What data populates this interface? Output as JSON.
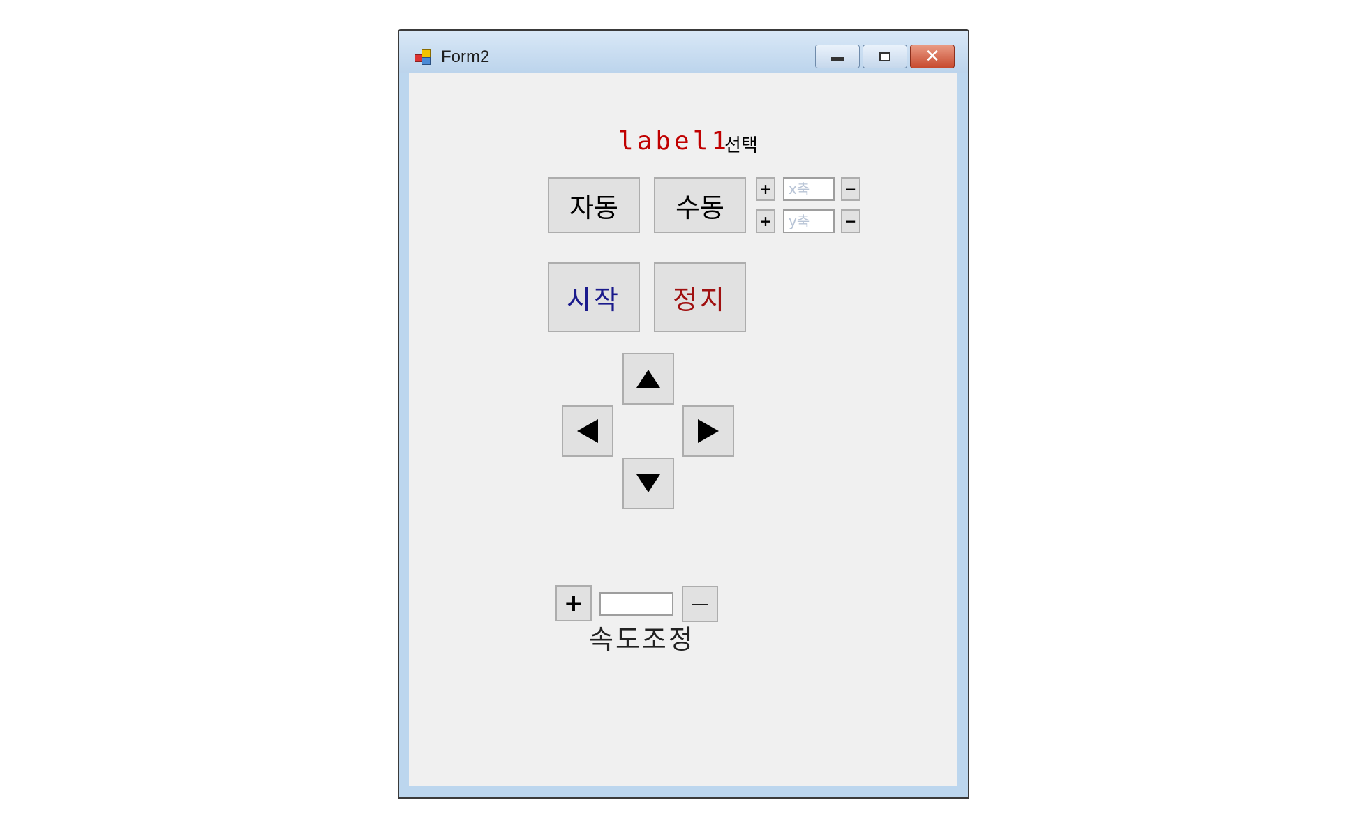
{
  "window": {
    "title": "Form2"
  },
  "labels": {
    "label1": "label1",
    "select": "선택",
    "speed": "속도조정"
  },
  "buttons": {
    "auto": "자동",
    "manual": "수동",
    "start": "시작",
    "stop": "정지",
    "x_plus": "+",
    "x_minus": "−",
    "y_plus": "+",
    "y_minus": "−",
    "speed_plus": "+",
    "speed_minus": "—"
  },
  "inputs": {
    "x_axis": {
      "placeholder": "x축",
      "value": ""
    },
    "y_axis": {
      "placeholder": "y축",
      "value": ""
    },
    "speed": {
      "placeholder": "",
      "value": ""
    }
  },
  "colors": {
    "label1": "#c00000",
    "start": "#1a1a8c",
    "stop": "#a01010",
    "close_button": "#c74a2f"
  },
  "icons": {
    "up": "arrow-up-icon",
    "down": "arrow-down-icon",
    "left": "arrow-left-icon",
    "right": "arrow-right-icon"
  }
}
